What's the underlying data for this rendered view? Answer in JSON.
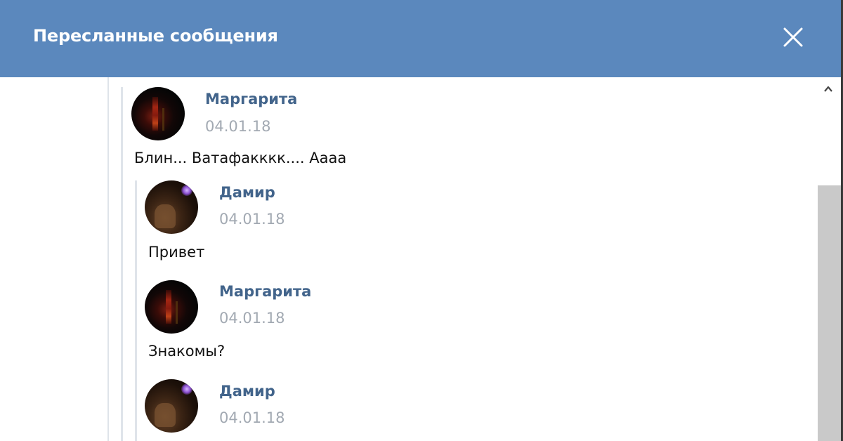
{
  "window": {
    "title": "Пересланные сообщения"
  },
  "icons": {
    "close": "close-icon",
    "scroll_up": "chevron-up-icon"
  },
  "colors": {
    "header_bg": "#5b88bd",
    "author": "#42648b",
    "date": "#a2a9b2",
    "thread_line": "#dfe4ea"
  },
  "messages": [
    {
      "author": "Маргарита",
      "date": "04.01.18",
      "text": "Блин... Ватафакккк.... Аааа",
      "avatar": "avatar-margarita"
    },
    {
      "author": "Дамир",
      "date": "04.01.18",
      "text": "Привет",
      "avatar": "avatar-damir"
    },
    {
      "author": "Маргарита",
      "date": "04.01.18",
      "text": "Знакомы?",
      "avatar": "avatar-margarita"
    },
    {
      "author": "Дамир",
      "date": "04.01.18",
      "text": "",
      "avatar": "avatar-damir"
    }
  ]
}
